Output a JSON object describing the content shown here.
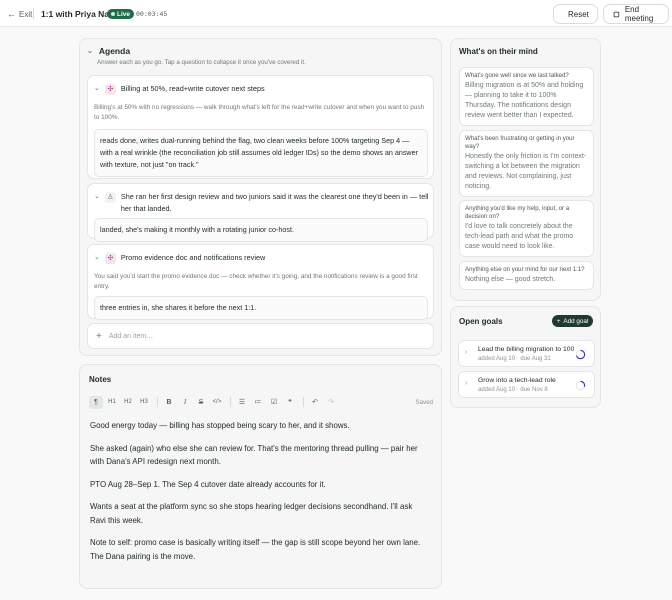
{
  "topbar": {
    "exit_label": "Exit",
    "title": "1:1 with Priya Nair",
    "live_label": "Live",
    "timer": "00:03:45",
    "reset_label": "Reset",
    "end_label": "End meeting"
  },
  "agenda": {
    "title": "Agenda",
    "subtitle": "Answer each as you go. Tap a question to collapse it once you've covered it.",
    "items": [
      {
        "title": "Billing at 50%, read+write cutover next steps",
        "description": "Billing's at 50% with no regressions — walk through what's left for the read+write cutover and when you want to push to 100%.",
        "answer": "reads done, writes dual-running behind the flag, two clean weeks before 100% targeting Sep 4 — with a real wrinkle (the reconciliation job still assumes old ledger IDs) so the demo shows an answer with texture, not just \"on track.\""
      },
      {
        "title": "She ran her first design review and two juniors said it was the clearest one they'd been in — tell her that landed.",
        "description": "",
        "answer": "landed, she's making it monthly with a rotating junior co-host."
      },
      {
        "title": "Promo evidence doc and notifications review",
        "description": "You said you'd start the promo evidence doc — check whether it's going, and the notifications review is a good first entry.",
        "answer": "three entries in, she shares it before the next 1:1."
      }
    ],
    "add_placeholder": "Add an item…"
  },
  "notes": {
    "title": "Notes",
    "toolbar": {
      "paragraph": "¶",
      "h1": "H1",
      "h2": "H2",
      "h3": "H3",
      "bold": "B",
      "italic": "I",
      "strike": "S",
      "code": "</>",
      "saved": "Saved"
    },
    "paragraphs": [
      "Good energy today — billing has stopped being scary to her, and it shows.",
      "She asked (again) who else she can review for. That's the mentoring thread pulling — pair her with Dana's API redesign next month.",
      "PTO Aug 28–Sep 1. The Sep 4 cutover date already accounts for it.",
      "Wants a seat at the platform sync so she stops hearing ledger decisions secondhand. I'll ask Ravi this week.",
      "Note to self: promo case is basically writing itself — the gap is still scope beyond her own lane. The Dana pairing is the move."
    ]
  },
  "mind": {
    "title": "What's on their mind",
    "cards": [
      {
        "question": "What's gone well since we last talked?",
        "answer": "Billing migration is at 50% and holding — planning to take it to 100% Thursday. The notifications design review went better than I expected."
      },
      {
        "question": "What's been frustrating or getting in your way?",
        "answer": "Honestly the only friction is I'm context-switching a lot between the migration and reviews. Not complaining, just noticing."
      },
      {
        "question": "Anything you'd like my help, input, or a decision on?",
        "answer": "I'd love to talk concretely about the tech-lead path and what the promo case would need to look like."
      },
      {
        "question": "Anything else on your mind for our next 1:1?",
        "answer": "Nothing else — good stretch."
      }
    ]
  },
  "goals": {
    "title": "Open goals",
    "add_label": "Add goal",
    "items": [
      {
        "title": "Lead the billing migration to 100%",
        "meta": "added Aug 10 · due Aug 31",
        "progress": 0.7
      },
      {
        "title": "Grow into a tech-lead role",
        "meta": "added Aug 10 · due Nov 8",
        "progress": 0.3
      }
    ]
  }
}
